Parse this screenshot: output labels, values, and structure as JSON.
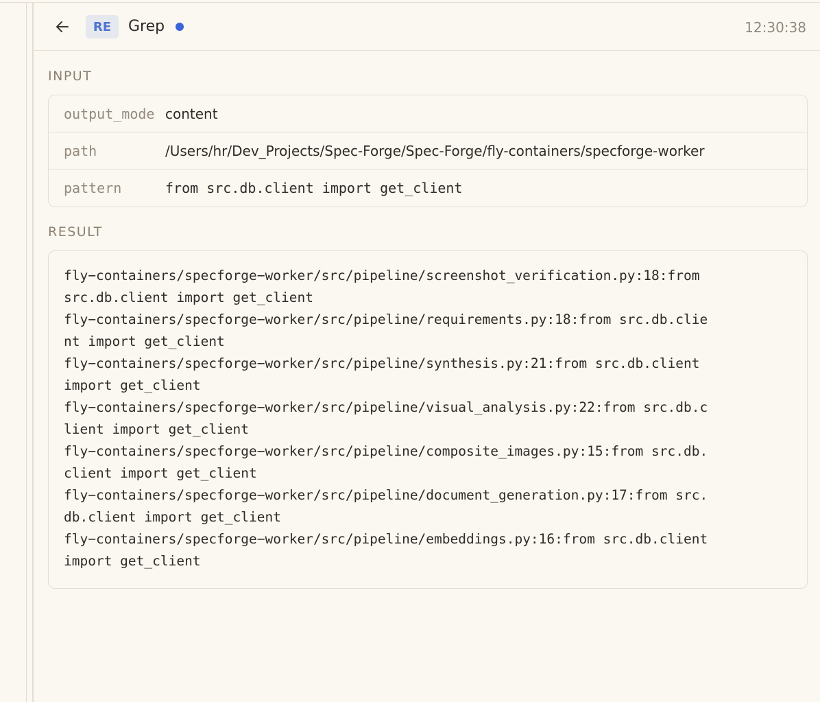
{
  "header": {
    "back_icon": "arrow-left-icon",
    "tool_badge": "RE",
    "tool_name": "Grep",
    "status_color": "#3a64d8",
    "timestamp": "12:30:38"
  },
  "input": {
    "label": "INPUT",
    "rows": [
      {
        "key": "output_mode",
        "value": "content"
      },
      {
        "key": "path",
        "value": "/Users/hr/Dev_Projects/Spec-Forge/Spec-Forge/fly-containers/specforge-worker"
      },
      {
        "key": "pattern",
        "value": "from src.db.client import get_client"
      }
    ]
  },
  "result": {
    "label": "RESULT",
    "lines": [
      "fly−containers/specforge−worker/src/pipeline/screenshot_verification.py:18:from",
      "src.db.client import get_client",
      "fly−containers/specforge−worker/src/pipeline/requirements.py:18:from src.db.clie",
      "nt import get_client",
      "fly−containers/specforge−worker/src/pipeline/synthesis.py:21:from src.db.client",
      "import get_client",
      "fly−containers/specforge−worker/src/pipeline/visual_analysis.py:22:from src.db.c",
      "lient import get_client",
      "fly−containers/specforge−worker/src/pipeline/composite_images.py:15:from src.db.",
      "client import get_client",
      "fly−containers/specforge−worker/src/pipeline/document_generation.py:17:from src.",
      "db.client import get_client",
      "fly−containers/specforge−worker/src/pipeline/embeddings.py:16:from src.db.client",
      "import get_client"
    ]
  }
}
